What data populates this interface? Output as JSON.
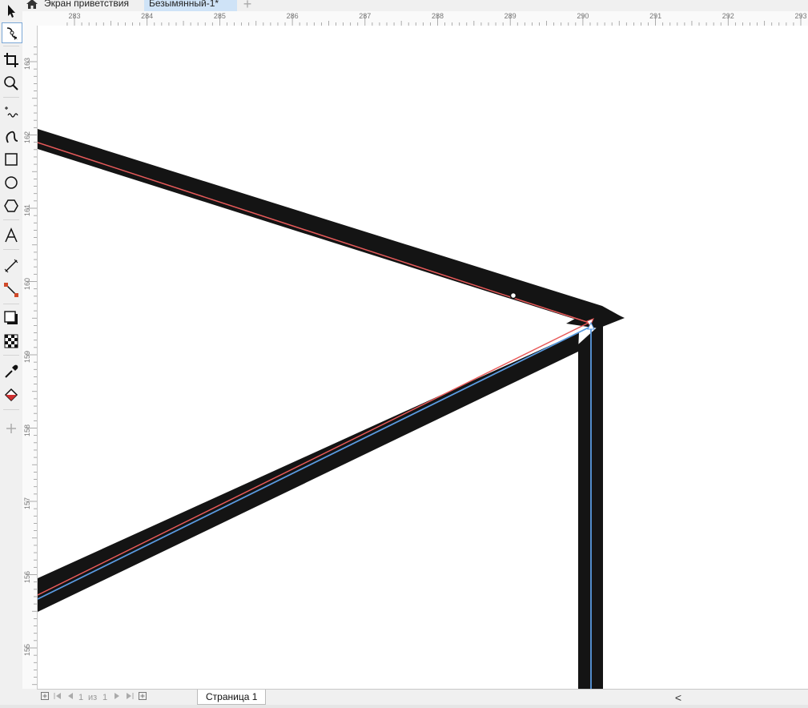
{
  "tabs": {
    "home_label": "Экран приветствия",
    "doc_label": "Безымянный-1*",
    "new_tab": "+"
  },
  "toolbox": {
    "tools": [
      "pick-tool",
      "shape-tool",
      "crop-tool",
      "zoom-tool",
      "freehand-tool",
      "artistic-media-tool",
      "rectangle-tool",
      "ellipse-tool",
      "polygon-tool",
      "text-tool",
      "parallel-dimension-tool",
      "connector-tool",
      "drop-shadow-tool",
      "transparency-tool",
      "eyedropper-tool",
      "interactive-fill-tool",
      "add-tool"
    ],
    "active_tool": "shape-tool"
  },
  "ruler": {
    "horizontal": [
      "283",
      "284",
      "285",
      "286",
      "287",
      "288",
      "289",
      "290",
      "291",
      "292",
      "293"
    ],
    "vertical": [
      "163",
      "162",
      "161",
      "160",
      "159",
      "158",
      "157",
      "156",
      "155"
    ]
  },
  "canvas": {
    "stroke_color": "#141414",
    "upper_path_color": "#e85a5a",
    "lower_path_color": "#5a9ae0",
    "node_color": "#ffffff"
  },
  "pagenav": {
    "current": "1",
    "of_label": "из",
    "total": "1",
    "page_tab_label": "Страница 1",
    "scroll_left": "<"
  }
}
